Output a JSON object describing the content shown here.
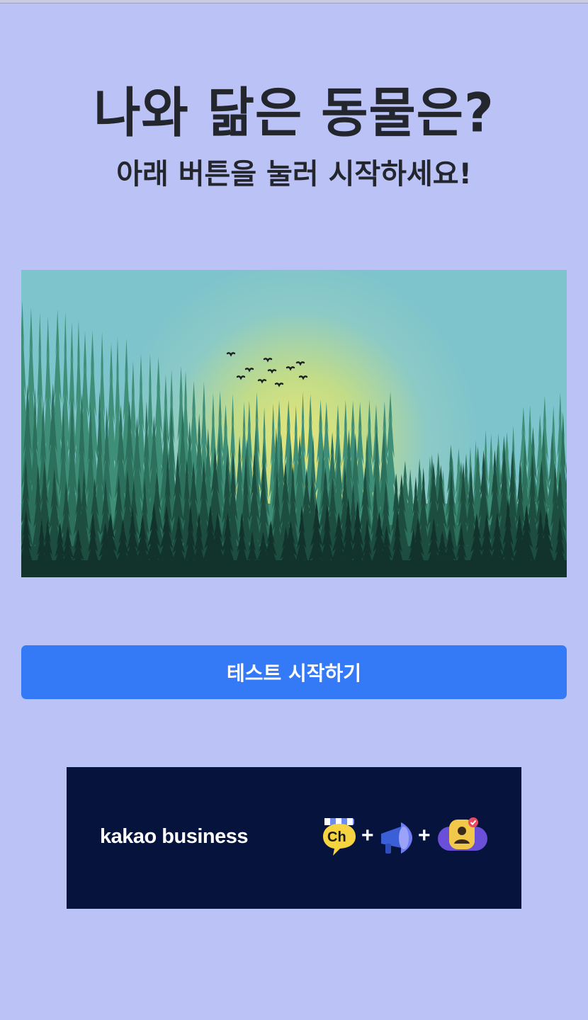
{
  "header": {
    "title": "나와 닮은 동물은?",
    "subtitle": "아래 버튼을 눌러 시작하세요!"
  },
  "hero": {
    "icon": "forest-sunrise-illustration"
  },
  "actions": {
    "start_label": "테스트 시작하기"
  },
  "ad": {
    "brand": "kakao business",
    "icons": [
      "channel-shop-icon",
      "megaphone-icon",
      "profile-check-icon"
    ],
    "channel_badge": "Ch",
    "plus": "+"
  },
  "colors": {
    "background": "#bbc2f6",
    "title": "#24262e",
    "button": "#347af7",
    "ad_background": "#06133d"
  }
}
